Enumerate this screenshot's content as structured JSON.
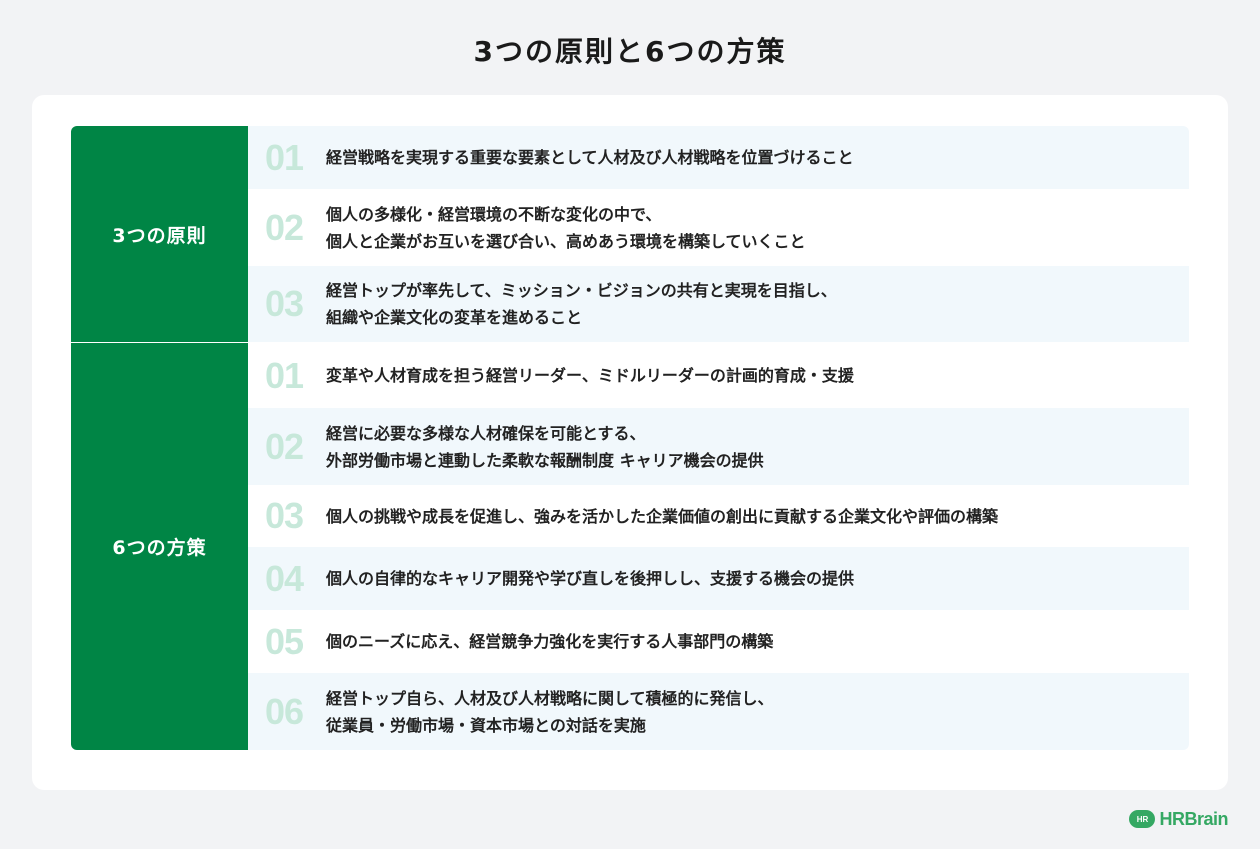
{
  "title": "3つの原則と6つの方策",
  "groups": [
    {
      "label": "3つの原則",
      "items": [
        {
          "num": "01",
          "text": "経営戦略を実現する重要な要素として人材及び人材戦略を位置づけること"
        },
        {
          "num": "02",
          "text": "個人の多様化・経営環境の不断な変化の中で、\n個人と企業がお互いを選び合い、高めあう環境を構築していくこと"
        },
        {
          "num": "03",
          "text": "経営トップが率先して、ミッション・ビジョンの共有と実現を目指し、\n組織や企業文化の変革を進めること"
        }
      ]
    },
    {
      "label": "6つの方策",
      "items": [
        {
          "num": "01",
          "text": "変革や人材育成を担う経営リーダー、ミドルリーダーの計画的育成・支援"
        },
        {
          "num": "02",
          "text": "経営に必要な多様な人材確保を可能とする、\n 外部労働市場と連動した柔軟な報酬制度 キャリア機会の提供"
        },
        {
          "num": "03",
          "text": "個人の挑戦や成長を促進し、強みを活かした企業価値の創出に貢献する企業文化や評価の構築"
        },
        {
          "num": "04",
          "text": "個人の自律的なキャリア開発や学び直しを後押しし、支援する機会の提供"
        },
        {
          "num": "05",
          "text": "個のニーズに応え、経営競争力強化を実行する人事部門の構築"
        },
        {
          "num": "06",
          "text": "経営トップ自ら、人材及び人材戦略に関して積極的に発信し、\n従業員・労働市場・資本市場との対話を実施"
        }
      ]
    }
  ],
  "brand": {
    "badge": "HR",
    "name": "HRBrain"
  },
  "colors": {
    "accent": "#008545",
    "number": "#c7e8da",
    "row_shade": "#f1f8fc",
    "brand": "#35a863"
  }
}
